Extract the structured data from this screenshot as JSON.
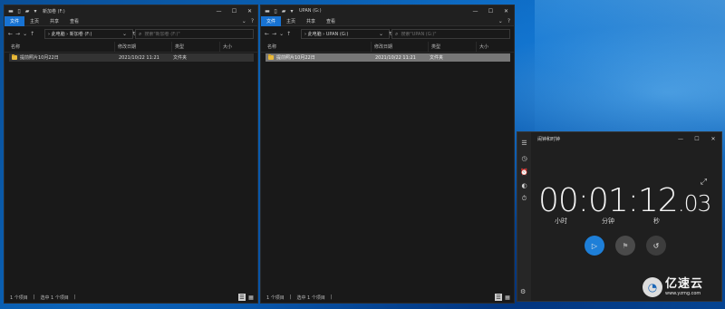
{
  "explorer_left": {
    "title": "新加卷 (F:)",
    "tabs": [
      "文件",
      "主页",
      "共享",
      "查看"
    ],
    "address": "› 此电脑 › 新加卷 (F:)",
    "search_placeholder": "搜索\"新加卷 (F:)\"",
    "columns": {
      "name": "名称",
      "date": "修改日期",
      "type": "类型",
      "size": "大小"
    },
    "rows": [
      {
        "name": "提前照片10月22日",
        "date": "2021/10/22 11:21",
        "type": "文件夹"
      }
    ],
    "status": {
      "count": "1 个项目",
      "selected": "选中 1 个项目"
    }
  },
  "explorer_right": {
    "title": "UPAN (G:)",
    "tabs": [
      "文件",
      "主页",
      "共享",
      "查看"
    ],
    "address": "› 此电脑 › UPAN (G:)",
    "search_placeholder": "搜索\"UPAN (G:)\"",
    "columns": {
      "name": "名称",
      "date": "修改日期",
      "type": "类型",
      "size": "大小"
    },
    "rows": [
      {
        "name": "提前照片10月22日",
        "date": "2021/10/22 11:21",
        "type": "文件夹"
      }
    ],
    "status": {
      "count": "1 个项目",
      "selected": "选中 1 个项目"
    }
  },
  "clock": {
    "title": "闹钟和时钟",
    "stopwatch": {
      "time": "00:01:12",
      "fraction": ".03"
    },
    "units": {
      "hours": "小时",
      "minutes": "分钟",
      "seconds": "秒"
    },
    "nav_icons": [
      "hamburger-icon",
      "timer-icon",
      "alarm-icon",
      "world-clock-icon",
      "stopwatch-icon",
      "settings-icon"
    ]
  },
  "watermark": {
    "brand": "亿速云",
    "url": "www.yzmg.com"
  },
  "colors": {
    "accent": "#1e7fd8",
    "file_tab": "#1873d3",
    "folder": "#e8b93a",
    "window_bg": "#191919"
  }
}
